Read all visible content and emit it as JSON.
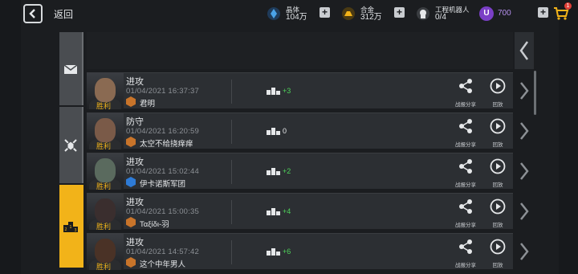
{
  "header": {
    "back_label": "返回",
    "crystal": {
      "label": "晶体",
      "value": "104万",
      "icon": "crystal-icon",
      "color": "#4aa3e8"
    },
    "alloy": {
      "label": "合金",
      "value": "312万",
      "icon": "alloy-icon",
      "color": "#f2b319"
    },
    "robots": {
      "label": "工程机器人",
      "value": "0/4",
      "icon": "robot-icon"
    },
    "premium": {
      "coin_letter": "U",
      "value": "700",
      "color": "#7a3fc6"
    },
    "cart_badge": "1"
  },
  "tabs": [
    {
      "icon": "mail-icon",
      "active": false
    },
    {
      "icon": "battle-crest-icon",
      "active": false
    },
    {
      "icon": "podium-icon",
      "active": true
    }
  ],
  "rows": [
    {
      "type": "进攻",
      "result": "胜利",
      "time": "01/04/2021 16:37:37",
      "opponent": "君明",
      "rank_icon": "bronze-rank-icon",
      "delta": "+3",
      "share": "战报分享",
      "replay": "回放"
    },
    {
      "type": "防守",
      "result": "胜利",
      "time": "01/04/2021 16:20:59",
      "opponent": "太空不给挠痒痒",
      "rank_icon": "bronze-rank-icon",
      "delta": "0",
      "share": "战报分享",
      "replay": "回放"
    },
    {
      "type": "进攻",
      "result": "胜利",
      "time": "01/04/2021 15:02:44",
      "opponent": "伊卡诺斯军团",
      "rank_icon": "blue-rank-icon",
      "delta": "+2",
      "share": "战报分享",
      "replay": "回放"
    },
    {
      "type": "进攻",
      "result": "胜利",
      "time": "01/04/2021 15:00:35",
      "opponent": "Ταξίδι-羽",
      "rank_icon": "bronze-rank-icon",
      "delta": "+4",
      "share": "战报分享",
      "replay": "回放"
    },
    {
      "type": "进攻",
      "result": "胜利",
      "time": "01/04/2021 14:57:42",
      "opponent": "这个中年男人",
      "rank_icon": "bronze-rank-icon",
      "delta": "+6",
      "share": "战报分享",
      "replay": "回放"
    }
  ]
}
